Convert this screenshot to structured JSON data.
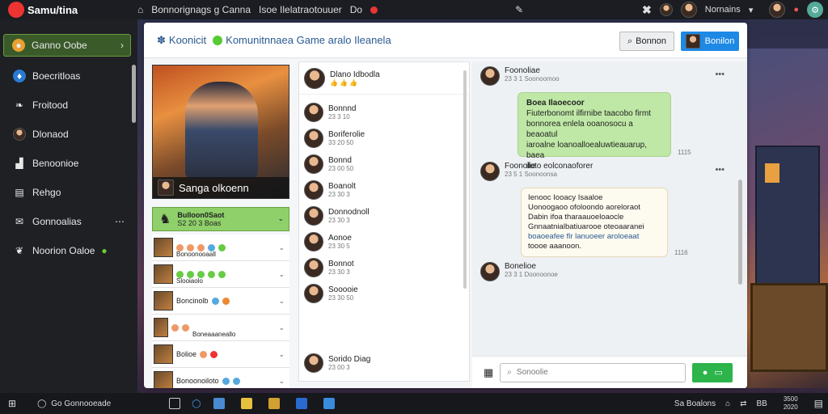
{
  "app": {
    "title": "Samu/tina"
  },
  "topbar": {
    "nav_text": "Bonnorignags g Canna",
    "nav_text2": "Isoe Ilelatraotouuer",
    "nav_badge_label": "Do",
    "user_name": "Nornains"
  },
  "sidebar": {
    "items": [
      {
        "label": "Ganno Oobe",
        "icon": "game-icon"
      },
      {
        "label": "Boecritloas",
        "icon": "shield-icon"
      },
      {
        "label": "Froitood",
        "icon": "leaf-icon"
      },
      {
        "label": "Dlonaod",
        "icon": "user-icon"
      },
      {
        "label": "Benoonioe",
        "icon": "chart-icon"
      },
      {
        "label": "Rehgo",
        "icon": "clipboard-icon"
      },
      {
        "label": "Gonnoalias",
        "icon": "mail-icon"
      },
      {
        "label": "Noorion Oaloe",
        "icon": "leaf-icon"
      }
    ]
  },
  "main": {
    "header": {
      "title_prefix": "Koonicit",
      "title": "Komunitnnaea Game aralo Ileanela"
    },
    "buttons": {
      "secondary": "Bonnon",
      "primary": "Bonilon"
    },
    "hero": {
      "caption": "Sanga olkoenn"
    },
    "selector": {
      "title": "Bulloon0Saot",
      "subtitle": "S2 20 3 Boas"
    },
    "game_rows": [
      {
        "label": "Bonoonooaall"
      },
      {
        "label": "Slooiaolo"
      },
      {
        "label": "Boncinolb"
      },
      {
        "label": "Boneaaaneallo"
      },
      {
        "label": "Bolioe"
      },
      {
        "label": "Bonoonoiloto"
      }
    ],
    "contacts": [
      {
        "name": "Dlano Idbodla",
        "sub": ""
      },
      {
        "name": "Bonnnd",
        "sub": "23 3 10"
      },
      {
        "name": "Boriferolie",
        "sub": "33 20 50"
      },
      {
        "name": "Bonnd",
        "sub": "23 00 50"
      },
      {
        "name": "Boanolt",
        "sub": "23 30 3"
      },
      {
        "name": "Donnodnoll",
        "sub": "23 30 3"
      },
      {
        "name": "Aonoe",
        "sub": "23 30 5"
      },
      {
        "name": "Bonnot",
        "sub": "23 30 3"
      },
      {
        "name": "Sooooie",
        "sub": "23 30 50"
      }
    ],
    "contact_bottom": {
      "name": "Sorido Diag",
      "sub": "23 00 3"
    },
    "messages": [
      {
        "name": "Foonoliae",
        "sub": "23 3 1 Soonoomoo"
      },
      {
        "name": "Foonolie",
        "sub": "23 5 1 Soonoonsa"
      },
      {
        "name": "Bonelioe",
        "sub": "23 3 1 Doonoonoe"
      }
    ],
    "bubble_green": {
      "title": "Boea Ilaoecoor",
      "lines": [
        "Fiuterbonomt ilfirnibe taacobo firmt",
        "bonnorea enlela ooanosocu a beaoatul",
        "iaroalne loanoalloealuwtieauarup, baea",
        "iloto eolconaoforer"
      ],
      "time": "1115"
    },
    "bubble_white": {
      "lines": [
        "Ienooc  Iooacy Isaaloe",
        "Uonoogaoo  ofoloondo aoreloraot",
        "Dabin  ifoa tharaauoeloaocle",
        "Gnnaatnialbatiuarooe oteoaaranei",
        "boaoeafee flr lanuoeer aroloeaat",
        "toooe aaanoon."
      ],
      "time": "1116"
    },
    "compose": {
      "placeholder": "Sonoolie"
    }
  },
  "taskbar": {
    "search": "Go Gonnooeade",
    "tray_text": "Sa Boalons",
    "tray_mid": "BB",
    "time": "3500",
    "date": "2020"
  },
  "colors": {
    "accent": "#1e88e5",
    "success": "#2db44a",
    "sidebar": "#1e2024"
  }
}
